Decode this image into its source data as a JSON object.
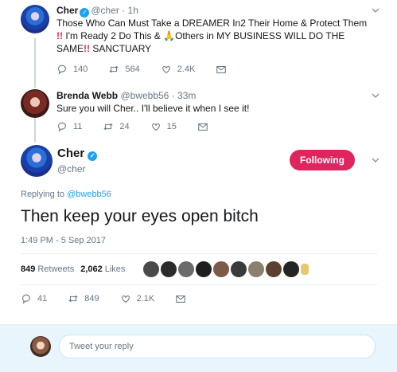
{
  "tweet1": {
    "name": "Cher",
    "handle": "@cher",
    "time": "1h",
    "text_a": "Those Who Can Must Take a DREAMER In2 Their Home & Protect Them",
    "bang1": "!!",
    "text_b": " I'm Ready 2 Do This & ",
    "hand_emoji": "🙏",
    "text_c": "Others in MY BUSINESS WILL DO THE SAME",
    "bang2": "!!",
    "text_d": " SANCTUARY",
    "replies": "140",
    "retweets": "564",
    "likes": "2.4K"
  },
  "tweet2": {
    "name": "Brenda Webb",
    "handle": "@bwebb56",
    "time": "33m",
    "text": "Sure you will Cher.. I'll believe it when I see it!",
    "replies": "11",
    "retweets": "24",
    "likes": "15"
  },
  "main": {
    "name": "Cher",
    "handle": "@cher",
    "follow_label": "Following",
    "replying_prefix": "Replying to ",
    "replying_handle": "@bwebb56",
    "text": "Then keep your eyes open bitch",
    "timestamp": "1:49 PM - 5 Sep 2017",
    "retweets_count": "849",
    "retweets_label": "Retweets",
    "likes_count": "2,062",
    "likes_label": "Likes",
    "action_replies": "41",
    "action_retweets": "849",
    "action_likes": "2.1K"
  },
  "reply_box": {
    "placeholder": "Tweet your reply"
  },
  "colors": {
    "accent": "#1da1f2",
    "following": "#e0245e",
    "muted": "#657786"
  }
}
